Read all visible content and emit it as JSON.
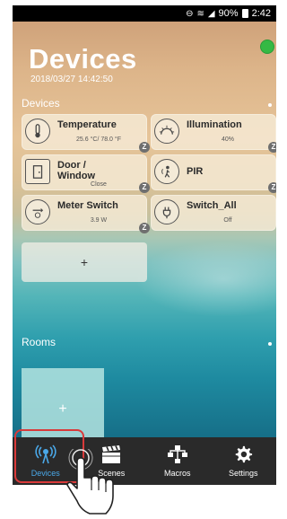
{
  "statusbar": {
    "battery": "90%",
    "time": "2:42"
  },
  "header": {
    "title": "Devices",
    "datetime": "2018/03/27 14:42:50"
  },
  "sections": {
    "devices_label": "Devices",
    "rooms_label": "Rooms"
  },
  "devices": [
    {
      "name": "Temperature",
      "value": "25.6 °C/ 78.0 °F",
      "icon": "thermometer-icon",
      "badge": "Z"
    },
    {
      "name": "Illumination",
      "value": "40%",
      "icon": "sun-icon",
      "badge": "Z"
    },
    {
      "name": "Door /\nWindow",
      "value": "Close",
      "icon": "door-icon",
      "badge": "Z"
    },
    {
      "name": "PIR",
      "value": "",
      "icon": "motion-sensor-icon",
      "badge": "Z"
    },
    {
      "name": "Meter Switch",
      "value": "3.9 W",
      "icon": "meter-icon",
      "badge": "Z"
    },
    {
      "name": "Switch_All",
      "value": "Off",
      "icon": "plug-icon",
      "badge": ""
    }
  ],
  "add_device": {
    "label": "+"
  },
  "add_room": {
    "label": "+"
  },
  "tabs": [
    {
      "label": "Devices",
      "icon": "radio-tower-icon",
      "active": true
    },
    {
      "label": "Scenes",
      "icon": "clapperboard-icon",
      "active": false
    },
    {
      "label": "Macros",
      "icon": "flowchart-icon",
      "active": false
    },
    {
      "label": "Settings",
      "icon": "gear-icon",
      "active": false
    }
  ],
  "colors": {
    "accent": "#4aa8e8",
    "online": "#35b944",
    "highlight": "#d93a3a",
    "tabbar": "#2a2a2a"
  }
}
